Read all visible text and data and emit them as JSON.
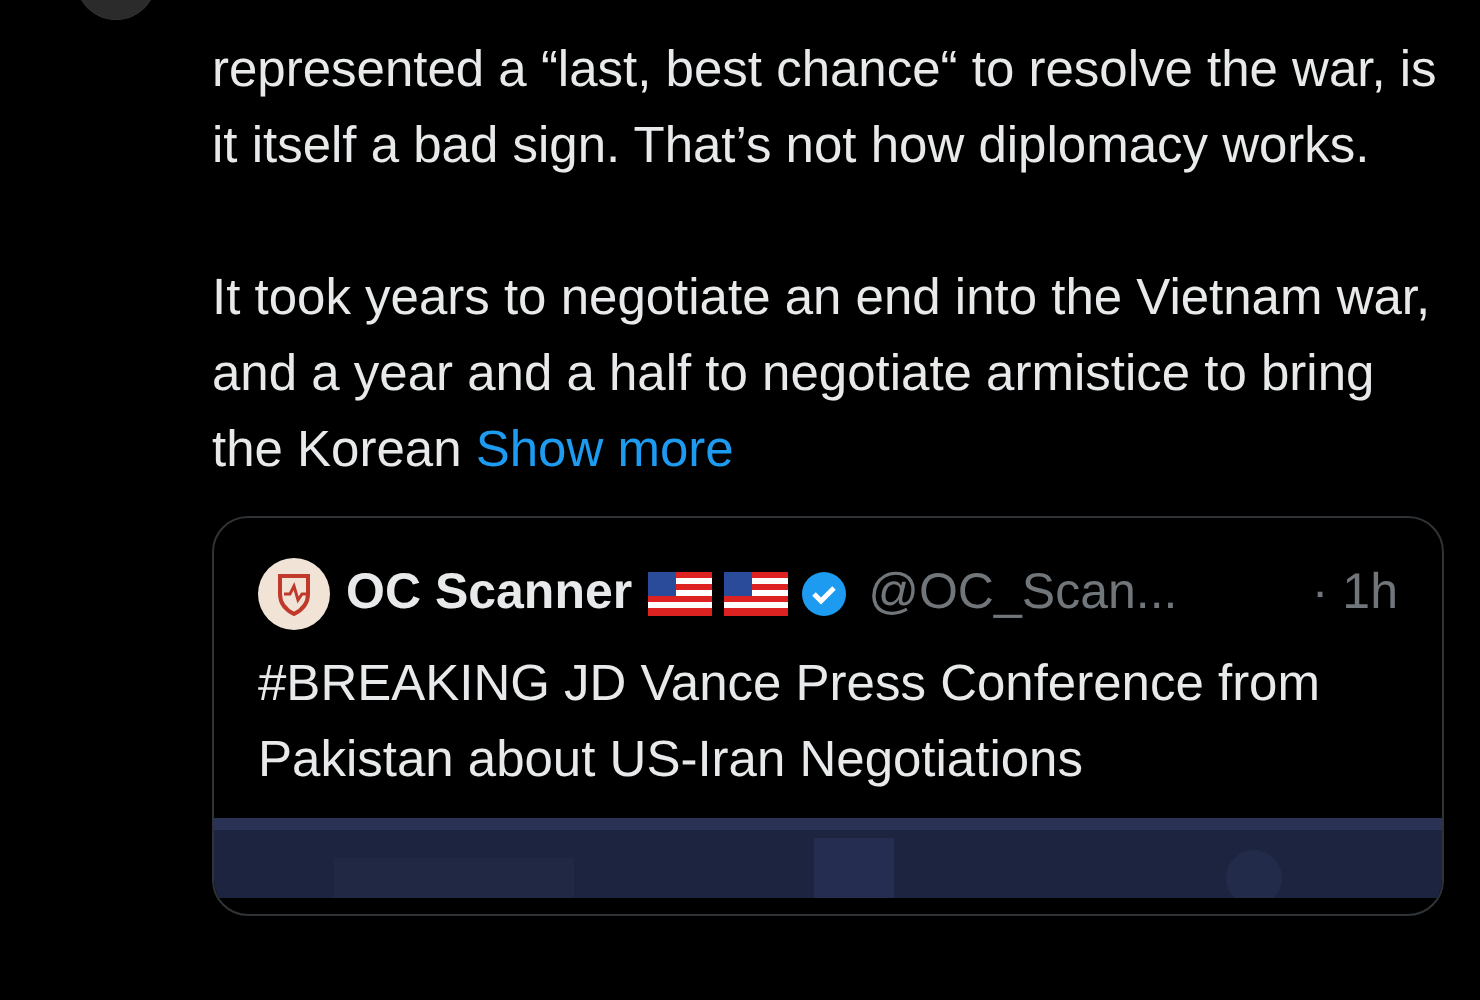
{
  "tweet": {
    "avatar": {
      "kind": "picture"
    },
    "paragraphs": [
      "represented a “last, best chance“ to resolve the war, is it itself a bad sign. That’s not how diplomacy works.",
      "It took years to negotiate an end into the Vietnam war, and a year and a half to negotiate armistice to bring the Korean"
    ],
    "show_more": "Show more",
    "quote": {
      "name": "OC Scanner",
      "badges": [
        {
          "kind": "flag"
        },
        {
          "kind": "flag"
        },
        {
          "kind": "verified"
        }
      ],
      "handle": "@OC_Scan...",
      "time": "· 1h",
      "text": "#BREAKING JD Vance Press Conference from Pakistan about US-Iran Negotiations",
      "media": {
        "kind": "picture"
      }
    }
  }
}
